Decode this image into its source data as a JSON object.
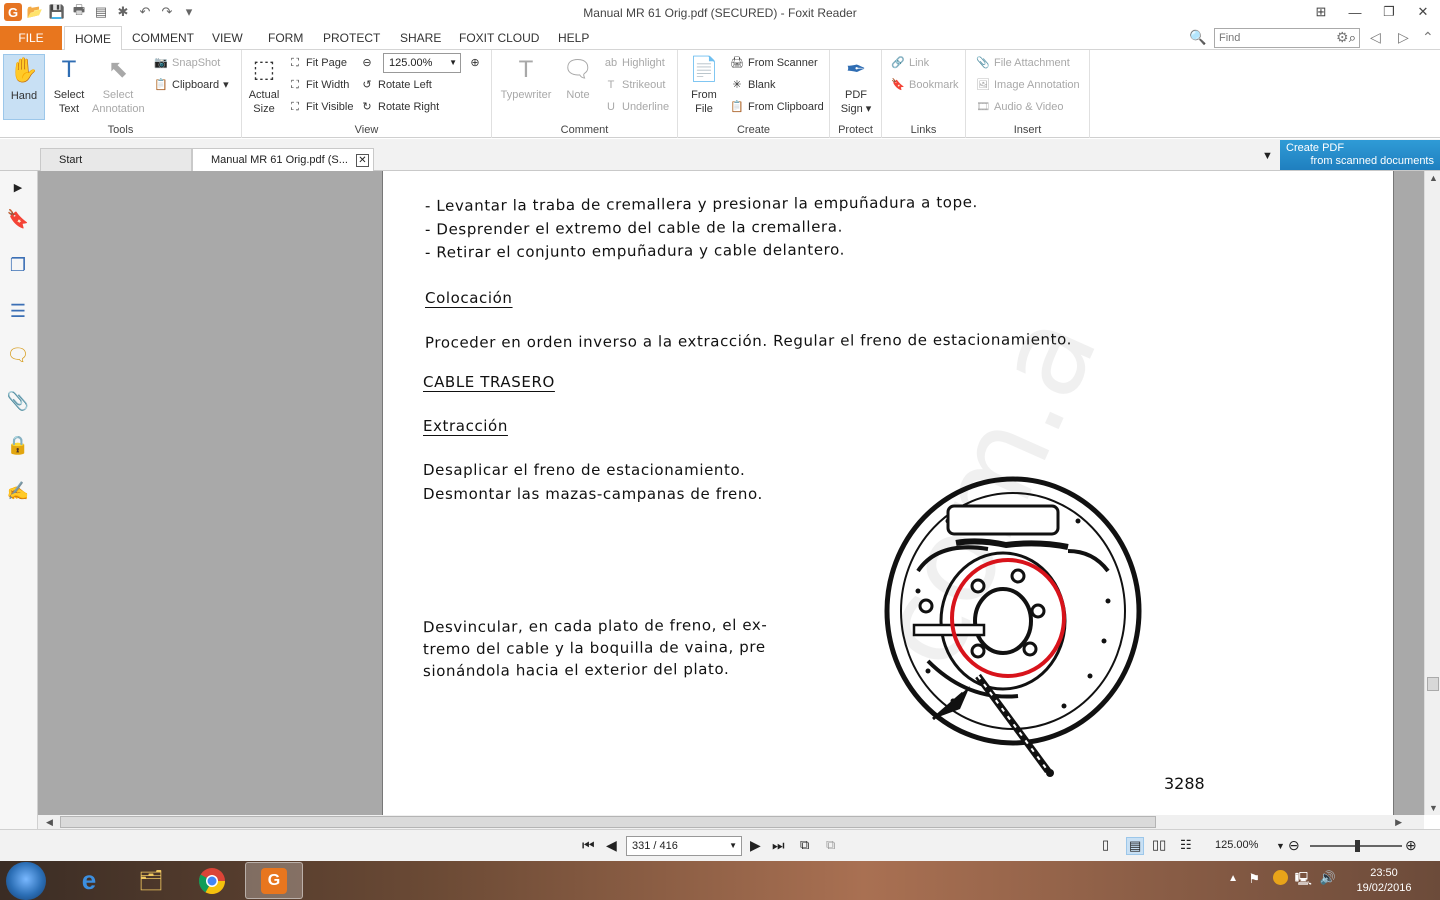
{
  "window": {
    "title": "Manual MR 61 Orig.pdf (SECURED) - Foxit Reader"
  },
  "ribbon_tabs": [
    "FILE",
    "HOME",
    "COMMENT",
    "VIEW",
    "FORM",
    "PROTECT",
    "SHARE",
    "FOXIT CLOUD",
    "HELP"
  ],
  "search": {
    "placeholder": "Find"
  },
  "ribbon": {
    "tools": {
      "label": "Tools",
      "hand": "Hand",
      "select_text_1": "Select",
      "select_text_2": "Text",
      "select_annotation_1": "Select",
      "select_annotation_2": "Annotation",
      "snapshot": "SnapShot",
      "clipboard": "Clipboard"
    },
    "view": {
      "label": "View",
      "actual_size_1": "Actual",
      "actual_size_2": "Size",
      "fit_page": "Fit Page",
      "fit_width": "Fit Width",
      "fit_visible": "Fit Visible",
      "zoom_value": "125.00%",
      "rotate_left": "Rotate Left",
      "rotate_right": "Rotate Right"
    },
    "comment": {
      "label": "Comment",
      "typewriter": "Typewriter",
      "note": "Note",
      "highlight": "Highlight",
      "strikeout": "Strikeout",
      "underline": "Underline"
    },
    "create": {
      "label": "Create",
      "from_file_1": "From",
      "from_file_2": "File",
      "from_scanner": "From Scanner",
      "blank": "Blank",
      "from_clipboard": "From Clipboard"
    },
    "protect": {
      "label": "Protect",
      "pdf_sign_1": "PDF",
      "pdf_sign_2": "Sign"
    },
    "links": {
      "label": "Links",
      "link": "Link",
      "bookmark": "Bookmark"
    },
    "insert": {
      "label": "Insert",
      "file_attachment": "File Attachment",
      "image_annotation": "Image Annotation",
      "audio_video": "Audio & Video"
    }
  },
  "doc_tabs": {
    "start": "Start",
    "current": "Manual MR 61 Orig.pdf (S..."
  },
  "banner": {
    "line1": "Create PDF",
    "line2": "from scanned documents"
  },
  "document": {
    "bullets": [
      "- Levantar la traba de cremallera y presionar la empuñadura a tope.",
      "- Desprender el extremo del cable de la cremallera.",
      "- Retirar el conjunto empuñadura y cable delantero."
    ],
    "h_colocacion": "Colocación",
    "p_colocacion": "Proceder en orden inverso a la extracción. Regular el freno de estacionamiento.",
    "h_cable": "CABLE TRASERO",
    "h_extraccion": "Extracción",
    "p_extraccion_1": "Desaplicar el freno de estacionamiento.",
    "p_extraccion_2": "Desmontar las mazas-campanas de freno.",
    "p_desvincular_1": "Desvincular, en cada plato de freno, el ex-",
    "p_desvincular_2": "tremo del cable y la boquilla de vaina, pre",
    "p_desvincular_3": "sionándola hacia el exterior del plato.",
    "figure_number": "3288",
    "watermark": "com.a"
  },
  "statusbar": {
    "page": "331 / 416",
    "zoom": "125.00%"
  },
  "taskbar": {
    "time": "23:50",
    "date": "19/02/2016"
  },
  "colors": {
    "file_tab": "#e8761e",
    "selected_tool": "#c8e0f4",
    "banner": "#2f9bd6",
    "annotation_circle": "#d8131b"
  }
}
